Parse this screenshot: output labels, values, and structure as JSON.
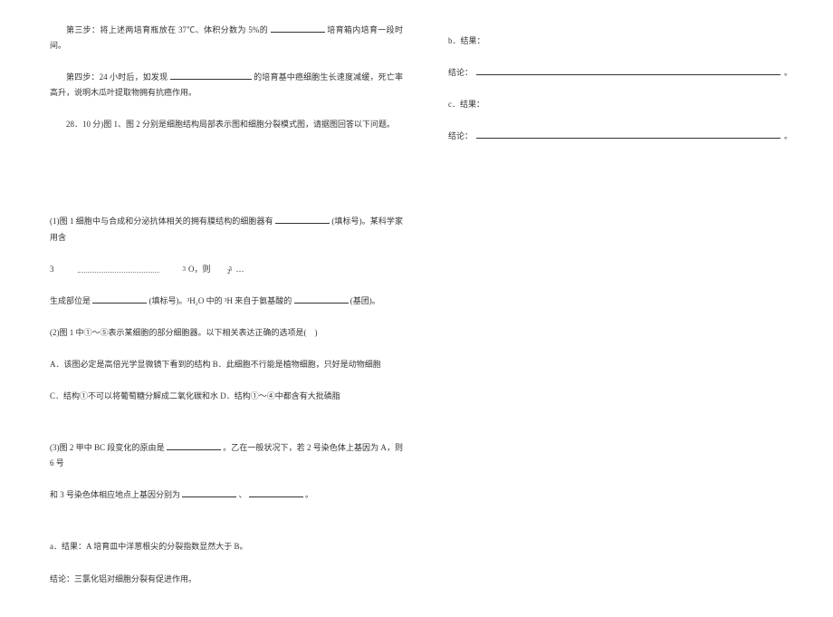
{
  "left": {
    "step3": "第三步：将上述两培育瓶放在 37℃、体积分数为 5%的",
    "step3_tail": "培育箱内培育一段时间。",
    "step4_a": "第四步：24 小时后，如发现",
    "step4_b": "的培育基中癌细胞生长速度减缓，死亡率高升，说明木瓜叶提取物拥有抗癌作用。",
    "q28": "28．10 分)图 1、图 2 分别是细胞结构局部表示图和细胞分裂模式图，请据图回答以下问题。",
    "p1_a": "(1)图 1 细胞中与合成和分泌抗体相关的拥有膜结构的细胞器有",
    "p1_b": "(填标号)。某科学家用含",
    "chem_pre": "3",
    "chem_O": "O，则",
    "chem_3": "3",
    "chem_2a": "2",
    "chem_2b": "2",
    "chem_tail": "…",
    "p1_c_a": "生成部位是",
    "p1_c_b": "(填标号)。³H₂O 中的 ³H 来自于氨基酸的",
    "p1_c_c": "(基团)。",
    "p2_head": "(2)图 1 中①～⑤表示某细胞的部分细胞器。以下相关表达正确的选项是(　)",
    "p2_AB": "A．该图必定是高倍光学显微镜下看到的结构 B．此细胞不行能是植物细胞，只好是动物细胞",
    "p2_CD": "C．结构①不可以将葡萄糖分解成二氧化碳和水 D．结构①～④中都含有大批磷脂",
    "p3_a": "(3)图 2 甲中 BC 段变化的原由是",
    "p3_b": "。乙在一般状况下，若 2 号染色体上基因为 A，则 6 号",
    "p3_c_a": "和 3 号染色体相应地点上基因分别为",
    "p3_c_mid": "、",
    "p3_c_end": "。",
    "res_a": "a．结果：A 培育皿中洋葱根尖的分裂指数显然大于 B。",
    "concl": "结论：三氯化铝对细胞分裂有促进作用。"
  },
  "right": {
    "b_label": "b．结果：",
    "c_label": "c．结果：",
    "concl_label": "结论："
  }
}
